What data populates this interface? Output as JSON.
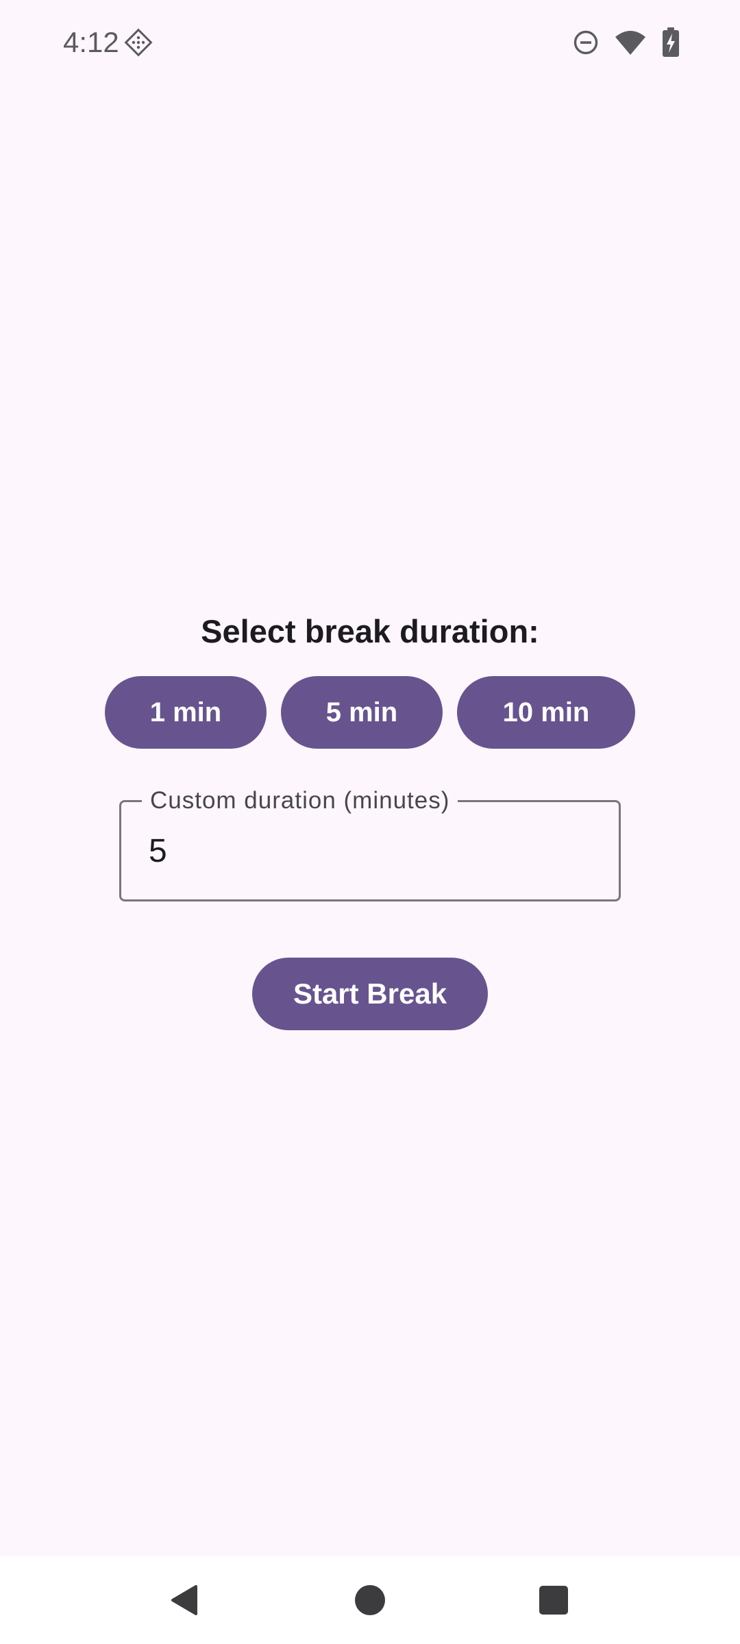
{
  "status_bar": {
    "time": "4:12",
    "left_icon": "assistant-diamond-icon",
    "right_icons": [
      "do-not-disturb-icon",
      "wifi-icon",
      "battery-charging-icon"
    ]
  },
  "main": {
    "heading": "Select break duration:",
    "presets": [
      {
        "label": "1 min"
      },
      {
        "label": "5 min"
      },
      {
        "label": "10 min"
      }
    ],
    "custom_field": {
      "label": "Custom duration (minutes)",
      "value": "5"
    },
    "start_button_label": "Start Break"
  },
  "nav_bar": {
    "icons": [
      "back-icon",
      "home-icon",
      "recents-icon"
    ]
  },
  "colors": {
    "background": "#fdf7fd",
    "accent": "#67548e",
    "text": "#1d1b20",
    "outline": "#79747e"
  }
}
